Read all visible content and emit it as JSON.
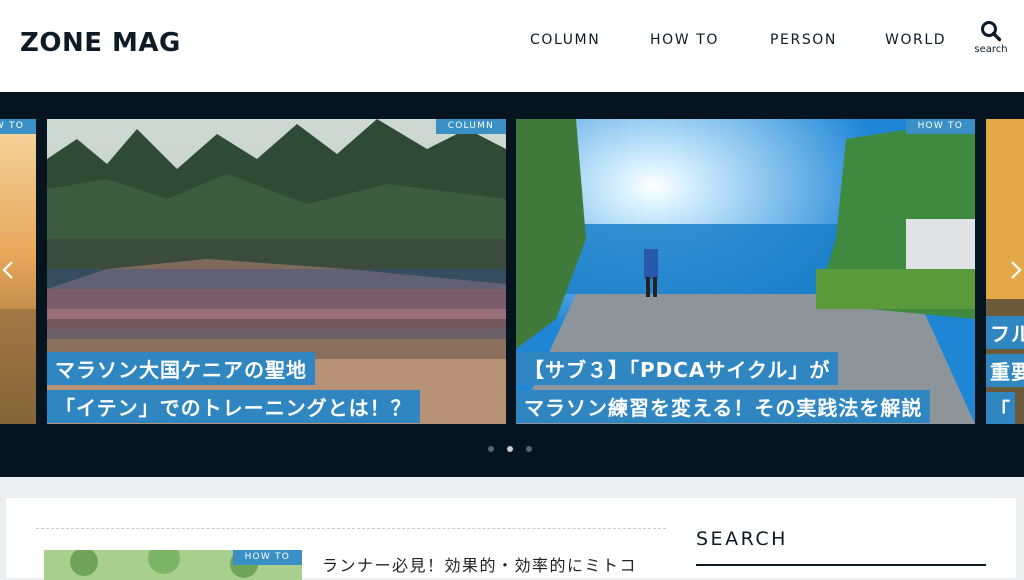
{
  "brand": {
    "name": "ZONE MAG"
  },
  "nav": {
    "items": [
      {
        "label": "COLUMN"
      },
      {
        "label": "HOW TO"
      },
      {
        "label": "PERSON"
      },
      {
        "label": "WORLD"
      }
    ],
    "search_label": "search"
  },
  "slider": {
    "slides": [
      {
        "badge": "HOW TO"
      },
      {
        "badge": "COLUMN",
        "caption_line1": "マラソン大国ケニアの聖地",
        "caption_line2": "「イテン」でのトレーニングとは！？"
      },
      {
        "badge": "HOW TO",
        "caption_line1": "【サブ３】「PDCAサイクル」が",
        "caption_line2": "マラソン練習を変える！その実践法を解説"
      },
      {
        "caption_line1": "フル",
        "caption_line2": "重要",
        "caption_line3": "「"
      }
    ],
    "dots": {
      "count": 3,
      "active_index": 1
    }
  },
  "content": {
    "article": {
      "badge": "HOW TO",
      "title": "ランナー必見！効果的・効率的にミトコ"
    },
    "sidebar": {
      "title": "SEARCH"
    }
  }
}
